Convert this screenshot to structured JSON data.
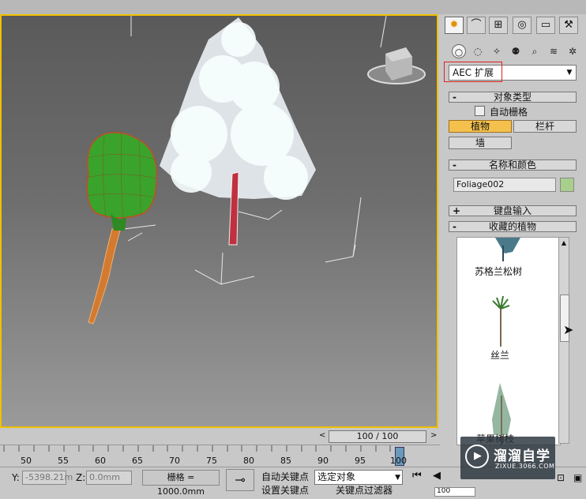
{
  "command_panel": {
    "main_tabs": [
      {
        "icon": "sun-icon",
        "glyph": "✹"
      },
      {
        "icon": "modify-icon",
        "glyph": "⌒"
      },
      {
        "icon": "hierarchy-icon",
        "glyph": "⊞"
      },
      {
        "icon": "motion-icon",
        "glyph": "◎"
      },
      {
        "icon": "display-icon",
        "glyph": "▭"
      },
      {
        "icon": "utilities-icon",
        "glyph": "⚒"
      }
    ],
    "sub_tabs": [
      {
        "icon": "geometry-icon",
        "glyph": "○"
      },
      {
        "icon": "shapes-icon",
        "glyph": "◌"
      },
      {
        "icon": "lights-icon",
        "glyph": "✧"
      },
      {
        "icon": "cameras-icon",
        "glyph": "⚉"
      },
      {
        "icon": "helpers-icon",
        "glyph": "⌕"
      },
      {
        "icon": "spacewarps-icon",
        "glyph": "≋"
      },
      {
        "icon": "systems-icon",
        "glyph": "✲"
      }
    ],
    "category_dropdown": "AEC 扩展",
    "object_type": {
      "header": "对象类型",
      "auto_grid": "自动栅格",
      "buttons": [
        "植物",
        "栏杆",
        "墙"
      ]
    },
    "name_color": {
      "header": "名称和颜色",
      "name_value": "Foliage002",
      "swatch_color": "#a8d08c"
    },
    "keyboard_entry": {
      "header": "键盘输入"
    },
    "favorites": {
      "header": "收藏的植物",
      "items": [
        "苏格兰松树",
        "丝兰",
        "苹果树枝"
      ]
    }
  },
  "timeline": {
    "slider_label": "100 / 100",
    "ticks": [
      "50",
      "55",
      "60",
      "65",
      "70",
      "75",
      "80",
      "85",
      "90",
      "95",
      "100"
    ]
  },
  "status": {
    "y_label": "Y:",
    "y_value": "-5398.21m",
    "z_label": "Z:",
    "z_value": "0.0mm",
    "grid_label": "栅格 = 1000.0mm",
    "auto_key": "自动关键点",
    "set_key": "设置关键点",
    "selection": "选定对象",
    "key_filter": "关键点过滤器",
    "frame_value": "100"
  },
  "watermark": {
    "brand": "溜溜自学",
    "url": "ZIXUE.3066.COM"
  },
  "colors": {
    "accent": "#f0c000",
    "active_button": "#f4c24c"
  }
}
